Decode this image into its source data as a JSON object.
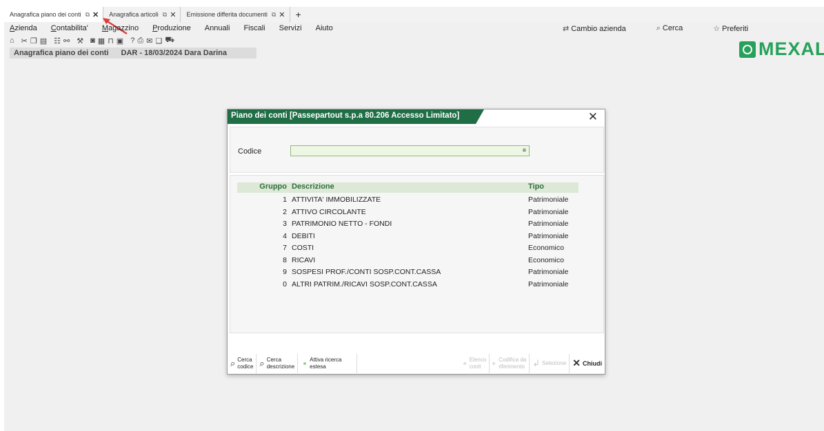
{
  "tabs": [
    {
      "label": "Anagrafica piano dei conti",
      "active": true
    },
    {
      "label": "Anagrafica articoli",
      "active": false
    },
    {
      "label": "Emissione differita documenti",
      "active": false
    }
  ],
  "tab_add": "+",
  "menu": [
    "Azienda",
    "Contabilita'",
    "Magazzino",
    "Produzione",
    "Annuali",
    "Fiscali",
    "Servizi",
    "Aiuto"
  ],
  "right_menu": {
    "cambio_azienda": "Cambio azienda",
    "cerca": "Cerca",
    "preferiti": "Preferiti"
  },
  "logo": "MEXAL",
  "breadcrumb": {
    "title": "Anagrafica piano dei conti",
    "context": "DAR - 18/03/2024  Dara Darina"
  },
  "dialog": {
    "title": "Piano dei conti [Passepartout s.p.a 80.206 Accesso Limitato]",
    "codice_label": "Codice",
    "codice_value": "",
    "columns": {
      "gruppo": "Gruppo",
      "descrizione": "Descrizione",
      "tipo": "Tipo"
    },
    "rows": [
      {
        "gruppo": "1",
        "descrizione": "ATTIVITA' IMMOBILIZZATE",
        "tipo": "Patrimoniale"
      },
      {
        "gruppo": "2",
        "descrizione": "ATTIVO CIRCOLANTE",
        "tipo": "Patrimoniale"
      },
      {
        "gruppo": "3",
        "descrizione": "PATRIMONIO NETTO - FONDI",
        "tipo": "Patrimoniale"
      },
      {
        "gruppo": "4",
        "descrizione": "DEBITI",
        "tipo": "Patrimoniale"
      },
      {
        "gruppo": "7",
        "descrizione": "COSTI",
        "tipo": "Economico"
      },
      {
        "gruppo": "8",
        "descrizione": "RICAVI",
        "tipo": "Economico"
      },
      {
        "gruppo": "9",
        "descrizione": "SOSPESI PROF./CONTI SOSP.CONT.CASSA",
        "tipo": "Patrimoniale"
      },
      {
        "gruppo": "0",
        "descrizione": "ALTRI PATRIM./RICAVI SOSP.CONT.CASSA",
        "tipo": "Patrimoniale"
      }
    ],
    "footer": {
      "cerca_codice": [
        "Cerca",
        "codice"
      ],
      "cerca_descrizione": [
        "Cerca",
        "descrizione"
      ],
      "attiva_ricerca": [
        "Attiva ricerca",
        "estesa"
      ],
      "elenco_conti": [
        "Elenco",
        "conti"
      ],
      "codifica": [
        "Codifica da",
        "riferimento"
      ],
      "selezione": "Selezione",
      "chiudi": "Chiudi"
    }
  },
  "colors": {
    "accent": "#1f6e45",
    "header_bg": "#dde8d6",
    "logo": "#26a15a"
  }
}
